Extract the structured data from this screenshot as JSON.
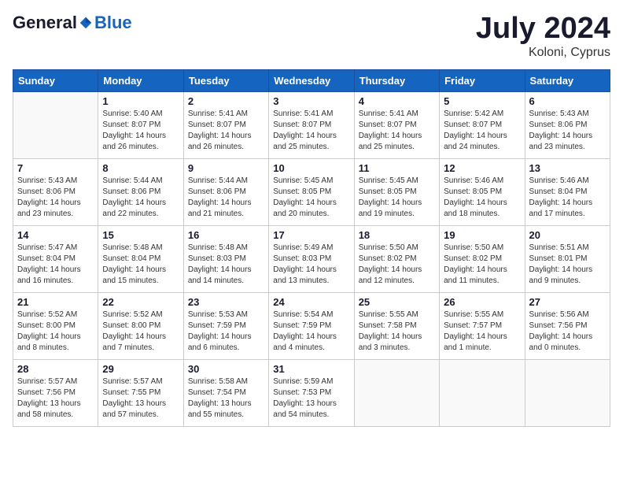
{
  "header": {
    "logo_general": "General",
    "logo_blue": "Blue",
    "title": "July 2024",
    "subtitle": "Koloni, Cyprus"
  },
  "days_of_week": [
    "Sunday",
    "Monday",
    "Tuesday",
    "Wednesday",
    "Thursday",
    "Friday",
    "Saturday"
  ],
  "weeks": [
    [
      {
        "day": "",
        "detail": ""
      },
      {
        "day": "1",
        "detail": "Sunrise: 5:40 AM\nSunset: 8:07 PM\nDaylight: 14 hours\nand 26 minutes."
      },
      {
        "day": "2",
        "detail": "Sunrise: 5:41 AM\nSunset: 8:07 PM\nDaylight: 14 hours\nand 26 minutes."
      },
      {
        "day": "3",
        "detail": "Sunrise: 5:41 AM\nSunset: 8:07 PM\nDaylight: 14 hours\nand 25 minutes."
      },
      {
        "day": "4",
        "detail": "Sunrise: 5:41 AM\nSunset: 8:07 PM\nDaylight: 14 hours\nand 25 minutes."
      },
      {
        "day": "5",
        "detail": "Sunrise: 5:42 AM\nSunset: 8:07 PM\nDaylight: 14 hours\nand 24 minutes."
      },
      {
        "day": "6",
        "detail": "Sunrise: 5:43 AM\nSunset: 8:06 PM\nDaylight: 14 hours\nand 23 minutes."
      }
    ],
    [
      {
        "day": "7",
        "detail": "Sunrise: 5:43 AM\nSunset: 8:06 PM\nDaylight: 14 hours\nand 23 minutes."
      },
      {
        "day": "8",
        "detail": "Sunrise: 5:44 AM\nSunset: 8:06 PM\nDaylight: 14 hours\nand 22 minutes."
      },
      {
        "day": "9",
        "detail": "Sunrise: 5:44 AM\nSunset: 8:06 PM\nDaylight: 14 hours\nand 21 minutes."
      },
      {
        "day": "10",
        "detail": "Sunrise: 5:45 AM\nSunset: 8:05 PM\nDaylight: 14 hours\nand 20 minutes."
      },
      {
        "day": "11",
        "detail": "Sunrise: 5:45 AM\nSunset: 8:05 PM\nDaylight: 14 hours\nand 19 minutes."
      },
      {
        "day": "12",
        "detail": "Sunrise: 5:46 AM\nSunset: 8:05 PM\nDaylight: 14 hours\nand 18 minutes."
      },
      {
        "day": "13",
        "detail": "Sunrise: 5:46 AM\nSunset: 8:04 PM\nDaylight: 14 hours\nand 17 minutes."
      }
    ],
    [
      {
        "day": "14",
        "detail": "Sunrise: 5:47 AM\nSunset: 8:04 PM\nDaylight: 14 hours\nand 16 minutes."
      },
      {
        "day": "15",
        "detail": "Sunrise: 5:48 AM\nSunset: 8:04 PM\nDaylight: 14 hours\nand 15 minutes."
      },
      {
        "day": "16",
        "detail": "Sunrise: 5:48 AM\nSunset: 8:03 PM\nDaylight: 14 hours\nand 14 minutes."
      },
      {
        "day": "17",
        "detail": "Sunrise: 5:49 AM\nSunset: 8:03 PM\nDaylight: 14 hours\nand 13 minutes."
      },
      {
        "day": "18",
        "detail": "Sunrise: 5:50 AM\nSunset: 8:02 PM\nDaylight: 14 hours\nand 12 minutes."
      },
      {
        "day": "19",
        "detail": "Sunrise: 5:50 AM\nSunset: 8:02 PM\nDaylight: 14 hours\nand 11 minutes."
      },
      {
        "day": "20",
        "detail": "Sunrise: 5:51 AM\nSunset: 8:01 PM\nDaylight: 14 hours\nand 9 minutes."
      }
    ],
    [
      {
        "day": "21",
        "detail": "Sunrise: 5:52 AM\nSunset: 8:00 PM\nDaylight: 14 hours\nand 8 minutes."
      },
      {
        "day": "22",
        "detail": "Sunrise: 5:52 AM\nSunset: 8:00 PM\nDaylight: 14 hours\nand 7 minutes."
      },
      {
        "day": "23",
        "detail": "Sunrise: 5:53 AM\nSunset: 7:59 PM\nDaylight: 14 hours\nand 6 minutes."
      },
      {
        "day": "24",
        "detail": "Sunrise: 5:54 AM\nSunset: 7:59 PM\nDaylight: 14 hours\nand 4 minutes."
      },
      {
        "day": "25",
        "detail": "Sunrise: 5:55 AM\nSunset: 7:58 PM\nDaylight: 14 hours\nand 3 minutes."
      },
      {
        "day": "26",
        "detail": "Sunrise: 5:55 AM\nSunset: 7:57 PM\nDaylight: 14 hours\nand 1 minute."
      },
      {
        "day": "27",
        "detail": "Sunrise: 5:56 AM\nSunset: 7:56 PM\nDaylight: 14 hours\nand 0 minutes."
      }
    ],
    [
      {
        "day": "28",
        "detail": "Sunrise: 5:57 AM\nSunset: 7:56 PM\nDaylight: 13 hours\nand 58 minutes."
      },
      {
        "day": "29",
        "detail": "Sunrise: 5:57 AM\nSunset: 7:55 PM\nDaylight: 13 hours\nand 57 minutes."
      },
      {
        "day": "30",
        "detail": "Sunrise: 5:58 AM\nSunset: 7:54 PM\nDaylight: 13 hours\nand 55 minutes."
      },
      {
        "day": "31",
        "detail": "Sunrise: 5:59 AM\nSunset: 7:53 PM\nDaylight: 13 hours\nand 54 minutes."
      },
      {
        "day": "",
        "detail": ""
      },
      {
        "day": "",
        "detail": ""
      },
      {
        "day": "",
        "detail": ""
      }
    ]
  ]
}
